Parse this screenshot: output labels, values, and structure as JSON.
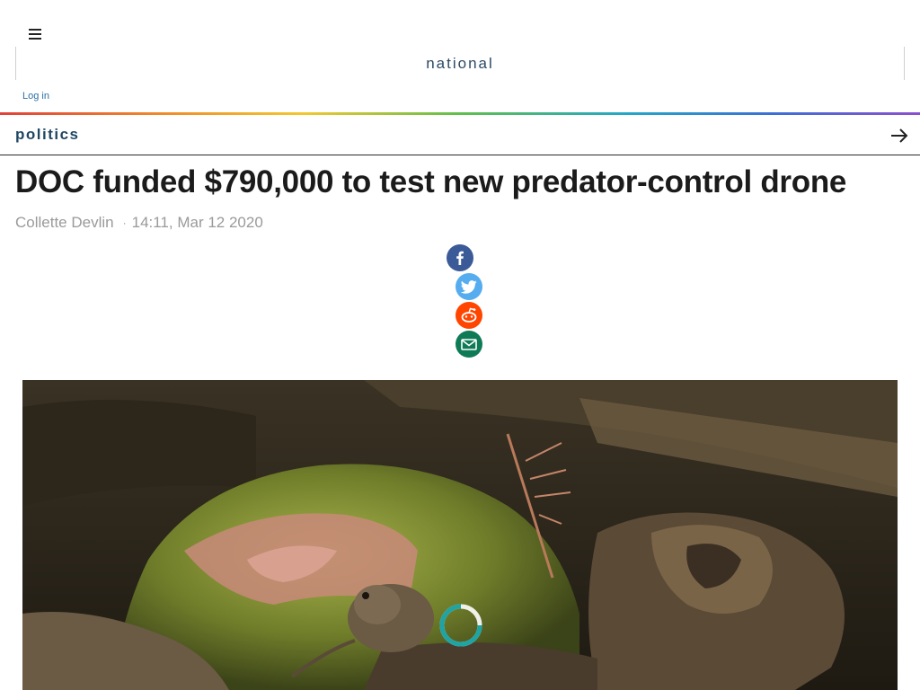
{
  "header": {
    "menu_icon": "hamburger-icon",
    "brand": "national",
    "login_label": "Log in"
  },
  "section": {
    "label": "politics",
    "arrow_icon": "arrow-right-icon"
  },
  "article": {
    "headline": "DOC funded $790,000 to test new predator-control drone",
    "author": "Collette Devlin",
    "separator": "·",
    "timestamp": "14:11, Mar 12 2020"
  },
  "share": [
    {
      "network": "facebook",
      "icon": "facebook-icon",
      "color": "#3a5a98"
    },
    {
      "network": "twitter",
      "icon": "twitter-icon",
      "color": "#55acee"
    },
    {
      "network": "reddit",
      "icon": "reddit-icon",
      "color": "#ff4500"
    },
    {
      "network": "email",
      "icon": "email-icon",
      "color": "#0f7b56"
    }
  ],
  "hero": {
    "loading_icon": "loading-spinner-icon"
  },
  "colors": {
    "brand_text": "#2b4a64",
    "section_text": "#1f4664",
    "link": "#2a6fa8",
    "byline": "#9a9a9a"
  }
}
